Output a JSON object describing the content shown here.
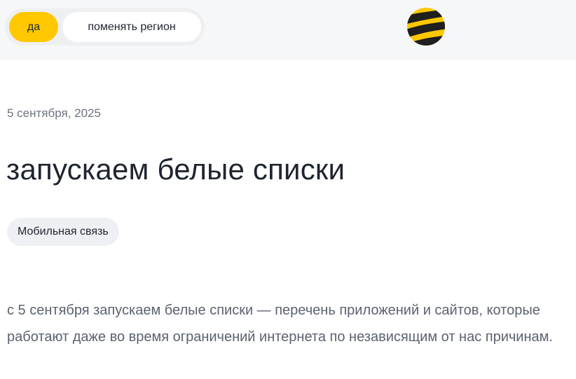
{
  "header": {
    "yes_label": "да",
    "change_region_label": "поменять регион",
    "logo": "beeline-bee-logo"
  },
  "article": {
    "date": "5 сентября, 2025",
    "title": "запускаем белые списки",
    "tag": "Мобильная связь",
    "body": "с 5 сентября запускаем белые списки — перечень приложений и сайтов, которые работают даже во время ограничений интернета по независящим от нас причинам."
  },
  "colors": {
    "accent": "#ffc800",
    "header_bg": "#f6f7f8",
    "text": "#1f2430",
    "muted": "#6b7280"
  }
}
